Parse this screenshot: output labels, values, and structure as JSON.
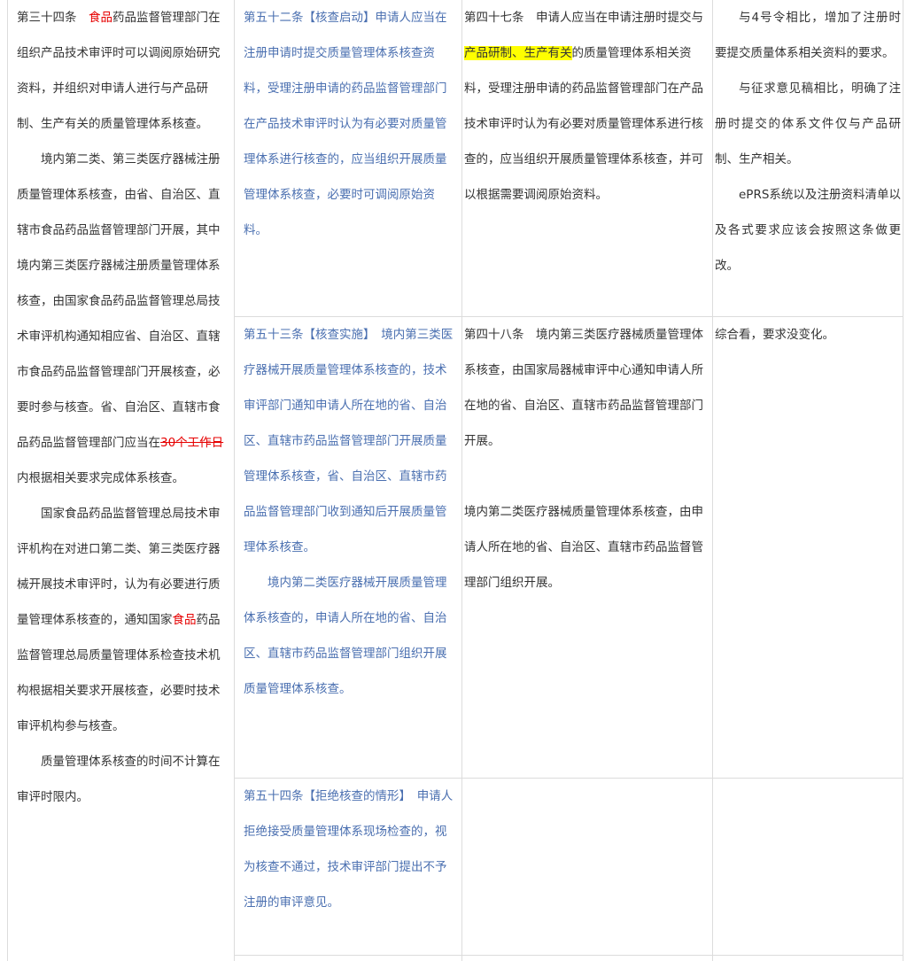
{
  "col1": {
    "p1_a": "第三十四条　",
    "p1_red": "食品",
    "p1_b": "药品监督管理部门在组织产品技术审评时可以调阅原始研究资料，并组织对申请人进行与产品研制、生产有关的质量管理体系核查。",
    "p2_a": "境内第二类、第三类医疗器械注册质量管理体系核查，由省、自治区、直辖市食品药品监督管理部门开展，其中境内第三类医疗器械注册质量管理体系核查，由国家食品药品监督管理总局技术审评机构通知相应省、自治区、直辖市食品药品监督管理部门开展核查，必要时参与核查。省、自治区、直辖市食品药品监督管理部门应当在",
    "p2_strike": "30个工作日",
    "p2_b": "内根据相关要求完成体系核查。",
    "p3_a": "国家食品药品监督管理总局技术审评机构在对进口第二类、第三类医疗器械开展技术审评时，认为有必要进行质量管理体系核查的，通知国家",
    "p3_red": "食品",
    "p3_b": "药品监督管理总局质量管理体系检查技术机构根据相关要求开展核查，必要时技术审评机构参与核查。",
    "p4": "质量管理体系核查的时间不计算在审评时限内。"
  },
  "col2": {
    "r1": "第五十二条【核查启动】申请人应当在注册申请时提交质量管理体系核查资料，受理注册申请的药品监督管理部门在产品技术审评时认为有必要对质量管理体系进行核查的，应当组织开展质量管理体系核查，必要时可调阅原始资料。",
    "r2_p1": "第五十三条【核查实施】　境内第三类医疗器械开展质量管理体系核查的，技术审评部门通知申请人所在地的省、自治区、直辖市药品监督管理部门开展质量管理体系核查，省、自治区、直辖市药品监督管理部门收到通知后开展质量管理体系核查。",
    "r2_p2": "境内第二类医疗器械开展质量管理体系核查的，申请人所在地的省、自治区、直辖市药品监督管理部门组织开展质量管理体系核查。",
    "r3": "第五十四条【拒绝核查的情形】　申请人拒绝接受质量管理体系现场检查的，视为核查不通过，技术审评部门提出不予注册的审评意见。"
  },
  "col3": {
    "r1_a": "第四十七条　申请人应当在申请注册时提交与",
    "r1_hl": "产品研制、生产有关",
    "r1_b": "的质量管理体系相关资料，受理注册申请的药品监督管理部门在产品技术审评时认为有必要对质量管理体系进行核查的，应当组织开展质量管理体系核查，并可以根据需要调阅原始资料。",
    "r2_p1": "第四十八条　境内第三类医疗器械质量管理体系核查，由国家局器械审评中心通知申请人所在地的省、自治区、直辖市药品监督管理部门开展。",
    "r2_p2": "境内第二类医疗器械质量管理体系核查，由申请人所在地的省、自治区、直辖市药品监督管理部门组织开展。"
  },
  "col4": {
    "r1_p1": "与4号令相比，增加了注册时要提交质量体系相关资料的要求。",
    "r1_p2": "与征求意见稿相比，明确了注册时提交的体系文件仅与产品研制、生产相关。",
    "r1_p3": "ePRS系统以及注册资料清单以及各式要求应该会按照这条做更改。",
    "r2": "综合看，要求没变化。"
  }
}
